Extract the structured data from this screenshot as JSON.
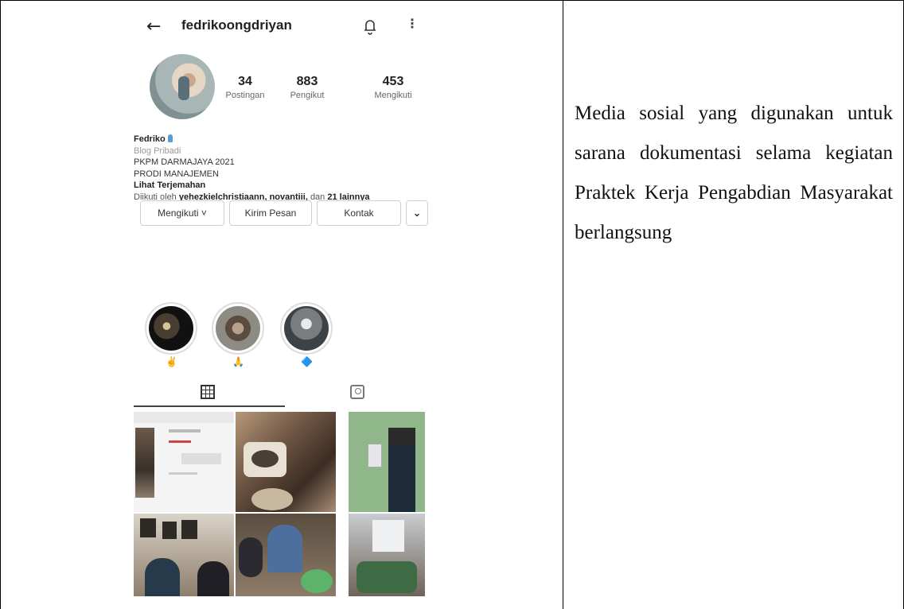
{
  "caption": "Media sosial yang digunakan untuk sarana dokumentasi selama kegiatan Praktek Kerja Pengabdian Masyarakat berlangsung",
  "profile": {
    "username": "fedrikoongdriyan",
    "stats": [
      {
        "value": "34",
        "label": "Postingan"
      },
      {
        "value": "883",
        "label": "Pengikut"
      },
      {
        "value": "453",
        "label": "Mengikuti"
      }
    ],
    "bio": {
      "name": "Fedriko",
      "category": "Blog Pribadi",
      "line1": "PKPM DARMAJAYA 2021",
      "line2": "PRODI MANAJEMEN",
      "translate": "Lihat Terjemahan",
      "followed_prefix": "Diikuti oleh",
      "followed_users": "yehezkielchristiaann, novantiii,",
      "followed_and": "dan",
      "followed_rest": "21 lainnya"
    },
    "buttons": {
      "following": "Mengikuti ˅",
      "message": "Kirim Pesan",
      "contact": "Kontak",
      "more": "⌄"
    },
    "highlight_emojis": [
      "✌",
      "🙏",
      "🔷"
    ]
  },
  "icons": {
    "back": "←",
    "more": "⋮"
  }
}
